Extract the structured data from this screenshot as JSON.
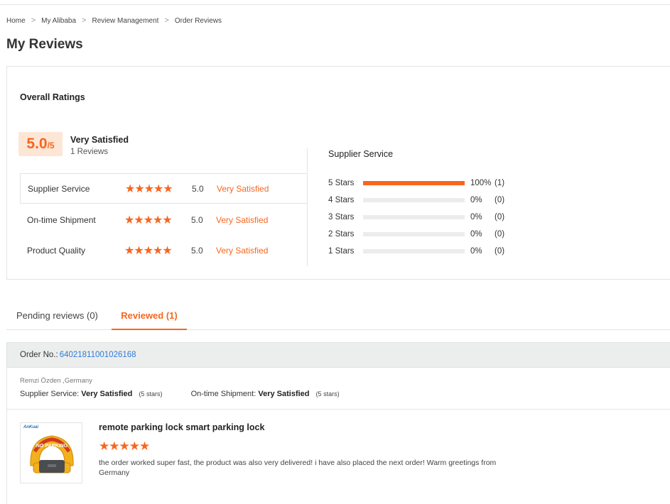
{
  "breadcrumb": {
    "items": [
      "Home",
      "My Alibaba",
      "Review Management",
      "Order Reviews"
    ],
    "separator": ">"
  },
  "page_title": "My Reviews",
  "overall": {
    "title": "Overall Ratings",
    "score": "5.0",
    "score_max": "/5",
    "satisfaction": "Very Satisfied",
    "reviews_count": "1 Reviews",
    "rows": [
      {
        "name": "Supplier Service",
        "stars": "★★★★★",
        "value": "5.0",
        "label": "Very Satisfied",
        "rating": 5
      },
      {
        "name": "On-time Shipment",
        "stars": "★★★★★",
        "value": "5.0",
        "label": "Very Satisfied",
        "rating": 5
      },
      {
        "name": "Product Quality",
        "stars": "★★★★★",
        "value": "5.0",
        "label": "Very Satisfied",
        "rating": 5
      }
    ]
  },
  "supplier_service": {
    "title": "Supplier Service",
    "distribution": [
      {
        "label": "5 Stars",
        "fraction": 1.0,
        "pct": "100%",
        "count": "(1)"
      },
      {
        "label": "4 Stars",
        "fraction": 0.0,
        "pct": "0%",
        "count": "(0)"
      },
      {
        "label": "3 Stars",
        "fraction": 0.0,
        "pct": "0%",
        "count": "(0)"
      },
      {
        "label": "2 Stars",
        "fraction": 0.0,
        "pct": "0%",
        "count": "(0)"
      },
      {
        "label": "1 Stars",
        "fraction": 0.0,
        "pct": "0%",
        "count": "(0)"
      }
    ]
  },
  "tabs": {
    "pending": "Pending reviews (0)",
    "reviewed": "Reviewed (1)",
    "active": "reviewed"
  },
  "order": {
    "label": "Order No.:",
    "number": "64021811001026168"
  },
  "review": {
    "reviewer": "Remzi Özden ,Germany",
    "supplier_label": "Supplier Service:",
    "supplier_value": "Very Satisfied",
    "supplier_stars": "(5 stars)",
    "shipment_label": "On-time Shipment:",
    "shipment_value": "Very Satisfied",
    "shipment_stars": "(5 stars)",
    "product_title": "remote parking lock smart parking lock",
    "product_stars": "★★★★★",
    "product_rating": 5,
    "text": "the order worked super fast, the product was also very delivered!  i have also placed the next order!  Warm greetings from Germany",
    "thumb_brand": "AnKuai",
    "thumb_sign": "NO PARKING"
  },
  "colors": {
    "accent": "#f7661f",
    "score_bg": "#fde6d6",
    "link": "#2f7bd6",
    "order_bar_bg": "#eceeee"
  }
}
